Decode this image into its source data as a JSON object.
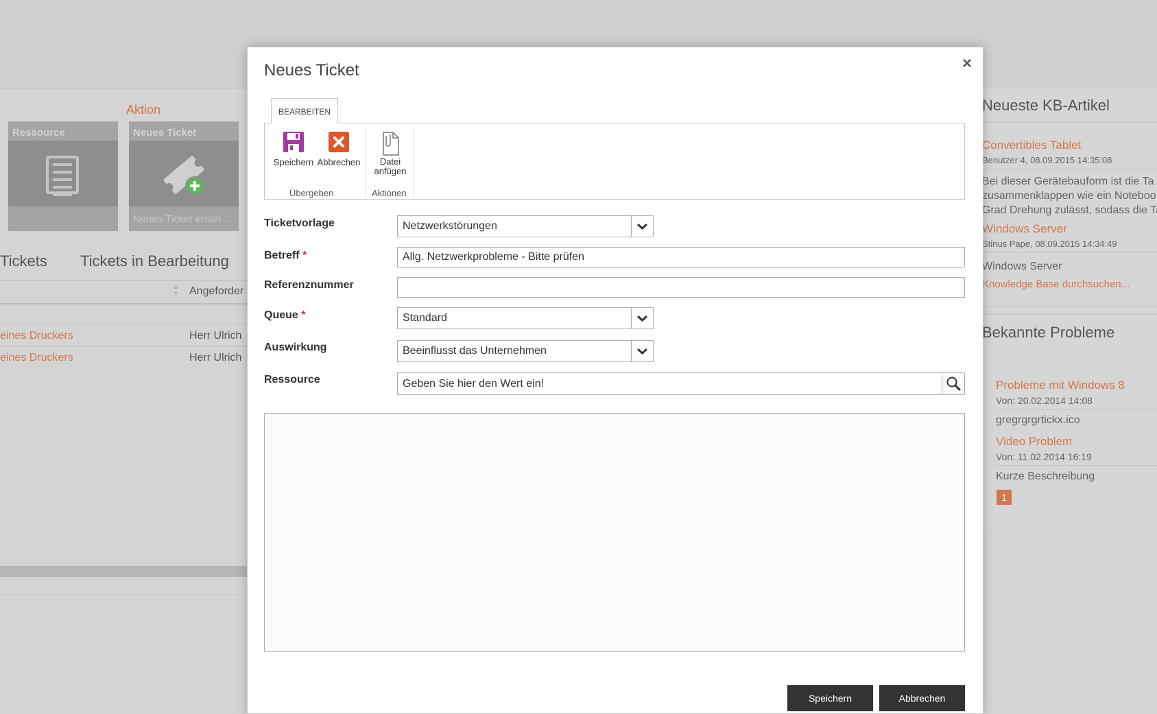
{
  "background": {
    "action_heading": "Aktion",
    "tiles": [
      {
        "title": "Ressource",
        "footer": ""
      },
      {
        "title": "Neues Ticket",
        "footer": "Neues Ticket erstel..."
      }
    ],
    "tabs": [
      "Tickets",
      "Tickets in Bearbeitung"
    ],
    "table": {
      "column": "Angeforder",
      "rows": [
        {
          "subject": "eines Druckers",
          "requester": "Herr Ulrich"
        },
        {
          "subject": "eines Druckers",
          "requester": "Herr Ulrich"
        }
      ]
    },
    "kb": {
      "heading": "Neueste KB-Artikel",
      "articles": [
        {
          "title": "Convertibles Tablet",
          "meta": "Benutzer 4, 08.09.2015 14:35:08",
          "lines": [
            "Bei dieser Gerätebauform ist die Ta",
            "zusammenklappen wie ein Noteboo",
            "Grad Drehung zulässt, sodass die Ta"
          ]
        },
        {
          "title": "Windows Server",
          "meta": "Stinus Pape, 08.09.2015 14:34:49",
          "lines": [
            "Windows Server"
          ]
        }
      ],
      "search_link": "Knowledge Base durchsuchen..."
    },
    "known_problems": {
      "heading": "Bekannte Probleme",
      "items": [
        {
          "title": "Probleme mit Windows 8",
          "date": "Von: 20.02.2014 14:08",
          "desc": "gregrgrgrtickx.ico"
        },
        {
          "title": "Video Problem",
          "date": "Von: 11.02.2014 16:19",
          "desc": "Kurze Beschreibung"
        }
      ],
      "page": "1"
    }
  },
  "dialog": {
    "title": "Neues Ticket",
    "close_icon": "×",
    "ribbon": {
      "tab_label": "BEARBEITEN",
      "save_label": "Speichern",
      "cancel_label": "Abbrechen",
      "attach_label_1": "Datei",
      "attach_label_2": "anfügen",
      "group_submit": "Übergeben",
      "group_actions": "Aktionen"
    },
    "form": {
      "template_label": "Ticketvorlage",
      "template_value": "Netzwerkstörungen",
      "subject_label": "Betreff",
      "subject_value": "Allg. Netzwerkprobleme - Bitte prüfen",
      "reference_label": "Referenznummer",
      "reference_value": "",
      "queue_label": "Queue",
      "queue_value": "Standard",
      "impact_label": "Auswirkung",
      "impact_value": "Beeinflusst das Unternehmen",
      "resource_label": "Ressource",
      "resource_placeholder": "Geben Sie hier den Wert ein!",
      "required_mark": "*"
    },
    "buttons": {
      "save": "Speichern",
      "cancel": "Abbrechen"
    }
  },
  "colors": {
    "accent": "#d4774a",
    "save_icon": "#a23ca0",
    "cancel_icon": "#e0552a",
    "button_dark": "#333333"
  }
}
